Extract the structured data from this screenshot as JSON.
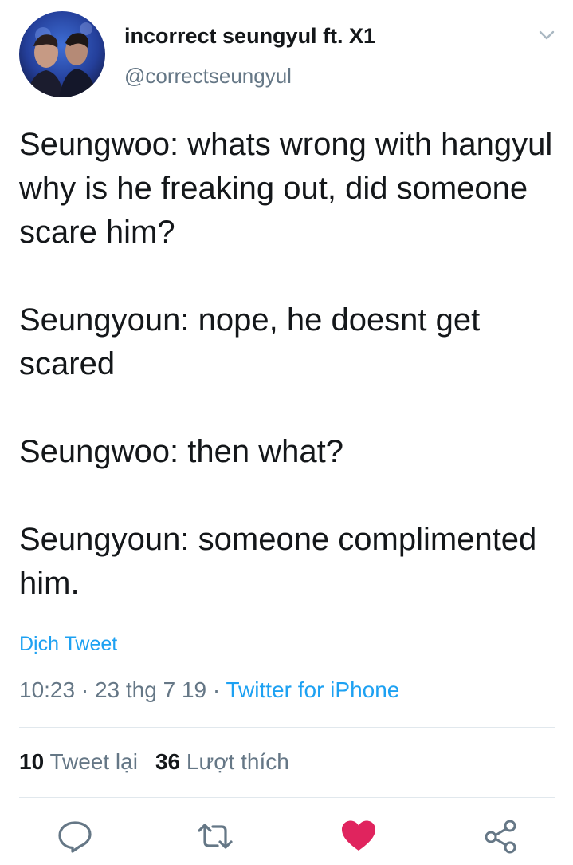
{
  "tweet": {
    "author": {
      "display_name": "incorrect seungyul ft. X1",
      "handle": "@correctseungyul",
      "avatar_icon": "avatar"
    },
    "caret_icon": "chevron-down-icon",
    "paragraphs": [
      "Seungwoo: whats wrong with hangyul why is he freaking out, did someone scare him?",
      "Seungyoun: nope, he doesnt get scared",
      "Seungwoo: then what?",
      "Seungyoun: someone complimented him."
    ],
    "translate_label": "Dịch Tweet",
    "time": "10:23",
    "date": "23 thg 7 19",
    "separator": " · ",
    "source": "Twitter for iPhone",
    "stats": {
      "retweets_count": "10",
      "retweets_label": "Tweet lại",
      "likes_count": "36",
      "likes_label": "Lượt thích"
    },
    "actions": [
      {
        "icon": "reply-icon"
      },
      {
        "icon": "retweet-icon"
      },
      {
        "icon": "heart-icon",
        "liked": true,
        "color": "#e0245e"
      },
      {
        "icon": "share-icon"
      }
    ]
  },
  "colors": {
    "text": "#14171a",
    "secondary": "#657786",
    "link": "#1da1f2",
    "like": "#e0245e",
    "divider": "#e1e8ed"
  }
}
